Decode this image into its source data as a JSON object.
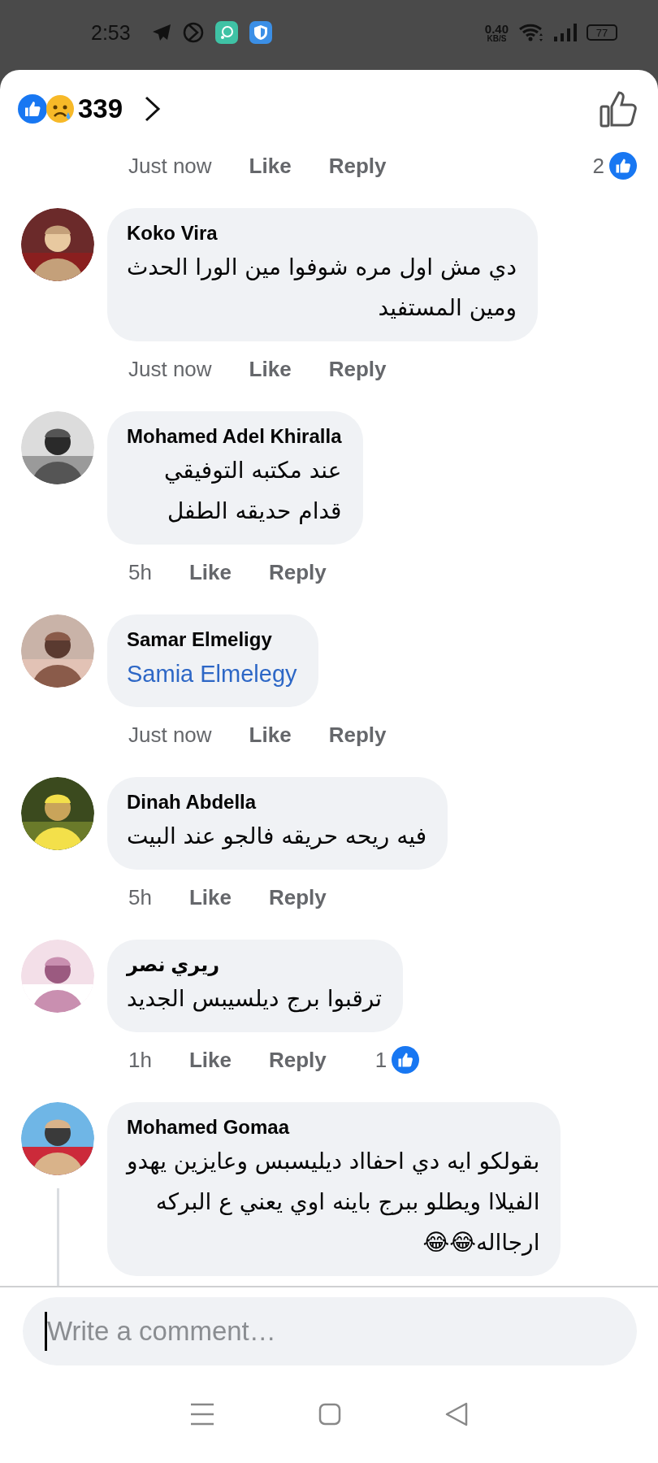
{
  "status_bar": {
    "time": "2:53",
    "speed": "0.40",
    "speed_unit": "KB/S",
    "battery": "77"
  },
  "header": {
    "reaction_count": "339"
  },
  "top_actions": {
    "time": "Just now",
    "like": "Like",
    "reply": "Reply",
    "reactions": "2"
  },
  "comments": [
    {
      "author": "Koko Vira",
      "kind": "text",
      "text": "دي مش اول مره شوفوا مين الورا  الحدث\nومين المستفيد",
      "time": "Just now",
      "like": "Like",
      "reply": "Reply",
      "thread": false
    },
    {
      "author": "Mohamed Adel Khiralla",
      "kind": "text",
      "text": "عند مكتبه التوفيقي\nقدام حديقه الطفل",
      "time": "5h",
      "like": "Like",
      "reply": "Reply",
      "thread": false
    },
    {
      "author": "Samar Elmeligy",
      "kind": "mention",
      "text": "Samia Elmelegy",
      "time": "Just now",
      "like": "Like",
      "reply": "Reply",
      "thread": false
    },
    {
      "author": "Dinah Abdella",
      "kind": "text",
      "text": "فيه ريحه حريقه فالجو عند البيت",
      "time": "5h",
      "like": "Like",
      "reply": "Reply",
      "thread": false
    },
    {
      "author": "ريري نصر",
      "kind": "text",
      "text": "ترقبوا برج ديلسيبس الجديد",
      "time": "1h",
      "like": "Like",
      "reply": "Reply",
      "reactions": "1",
      "thread": false
    },
    {
      "author": "Mohamed Gomaa",
      "kind": "text",
      "text": "بقولكو ايه دي احفااد ديليسبس وعايزين يهدو\nالفيلاا ويطلو ببرج باينه اوي يعني ع البركه\nارجااله😂😂",
      "thread": true
    }
  ],
  "composer": {
    "placeholder": "Write a comment…"
  }
}
